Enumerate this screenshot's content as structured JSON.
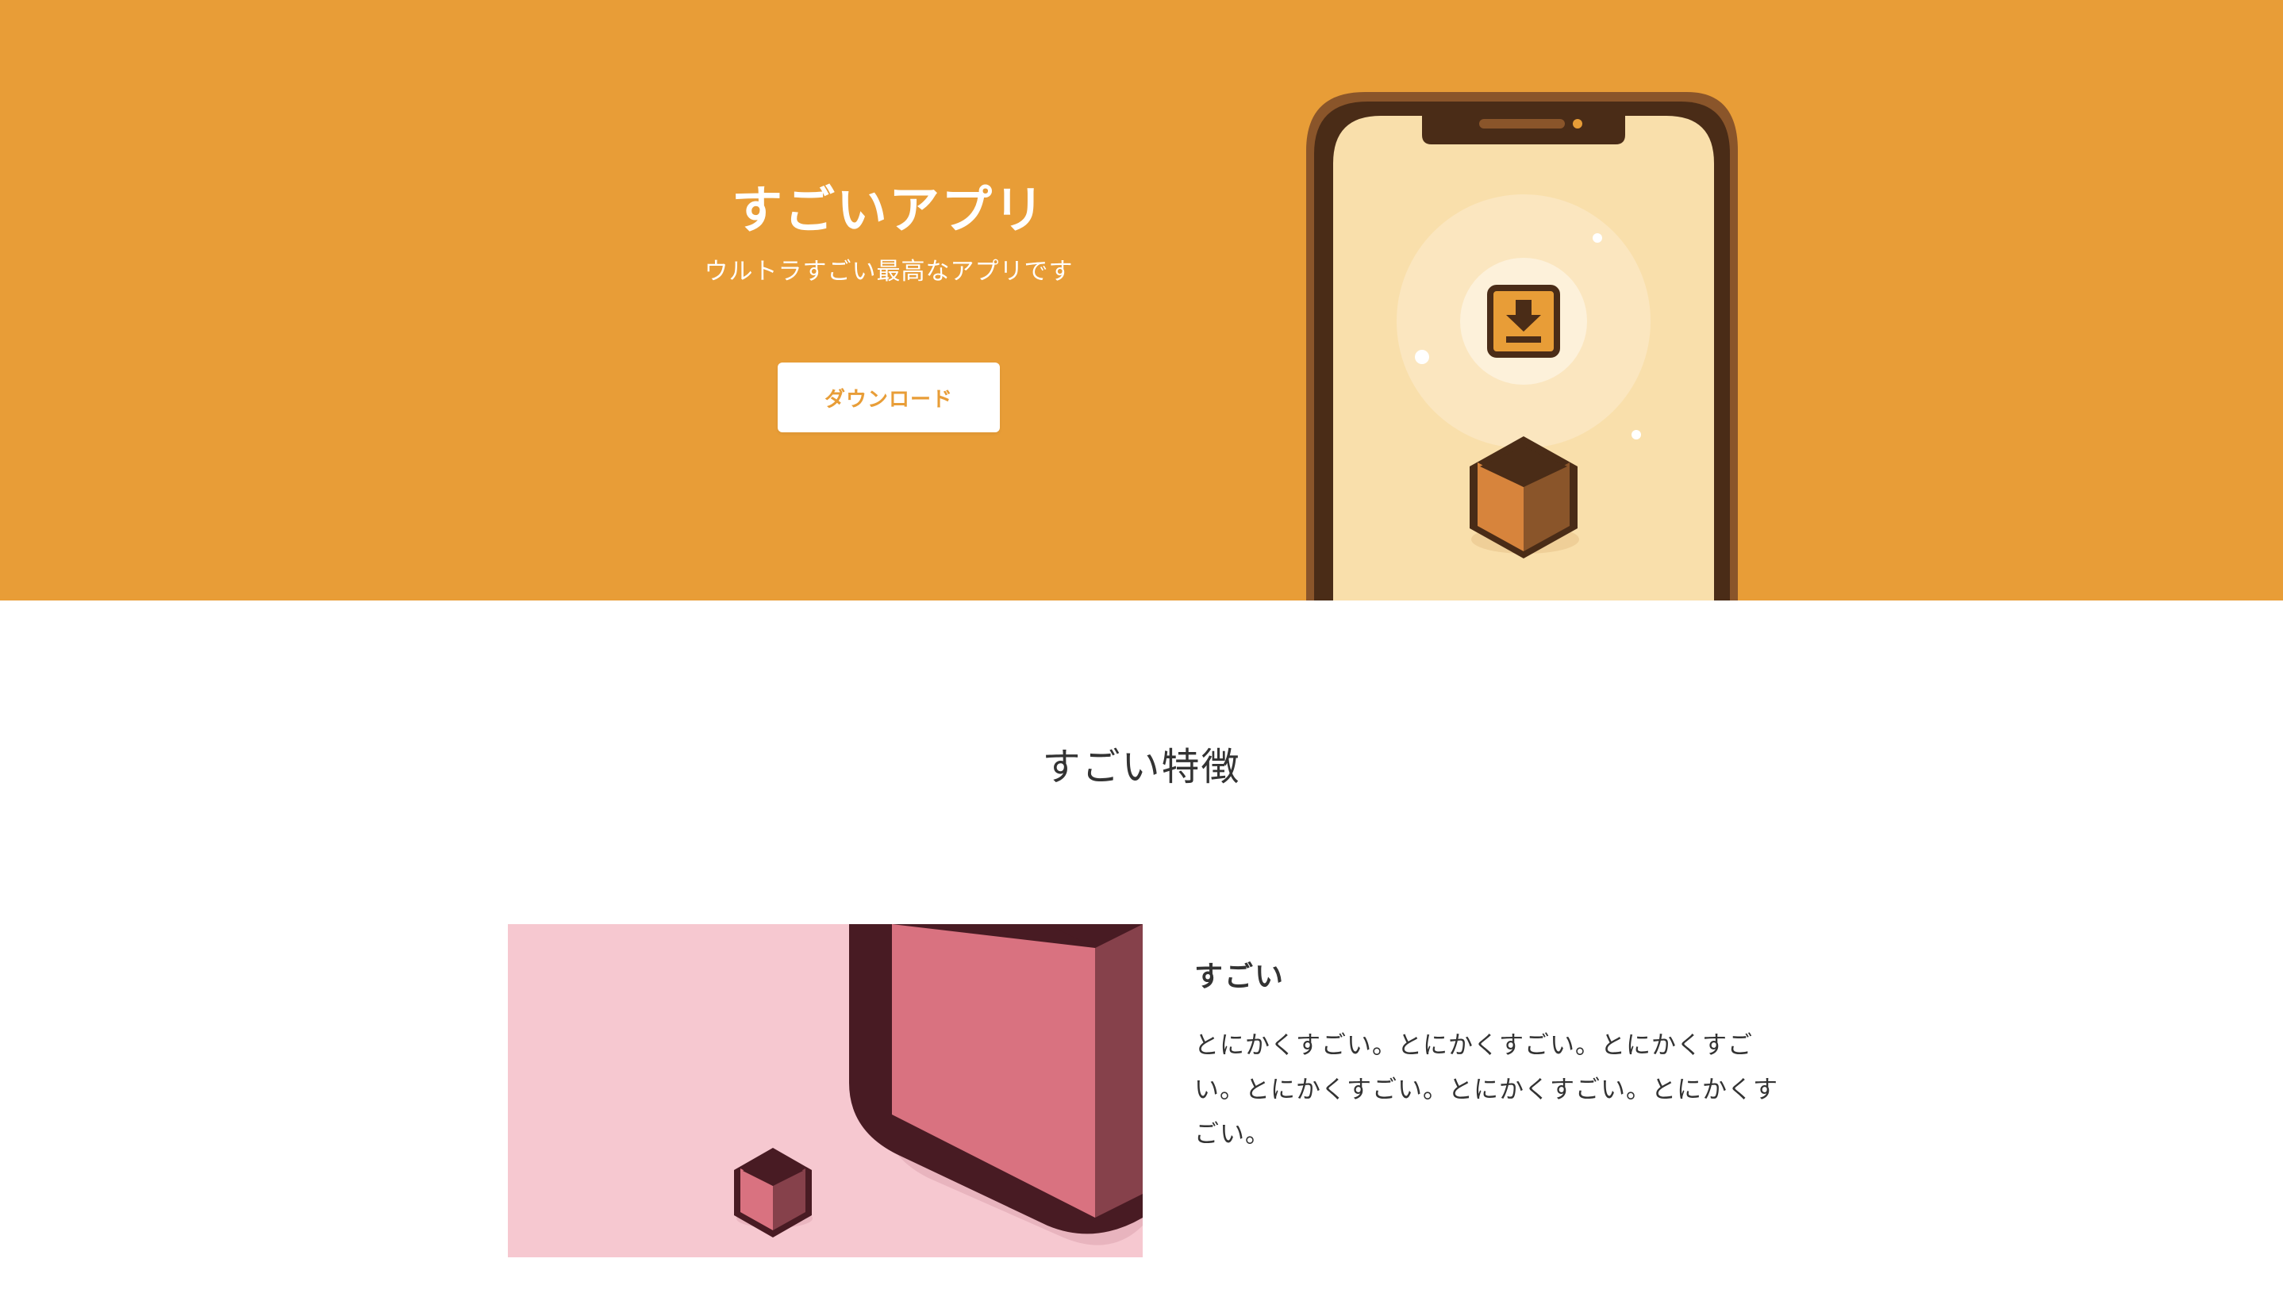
{
  "hero": {
    "title": "すごいアプリ",
    "subtitle": "ウルトラすごい最高なアプリです",
    "download_label": "ダウンロード",
    "background_color": "#e89d37",
    "button_text_color": "#e89d37"
  },
  "phone": {
    "icons": [
      "download-icon",
      "box-icon"
    ]
  },
  "features": {
    "heading": "すごい特徴",
    "items": [
      {
        "title": "すごい",
        "description": "とにかくすごい。とにかくすごい。とにかくすごい。とにかくすごい。とにかくすごい。とにかくすごい。",
        "image_background": "#f6c8d0"
      }
    ]
  }
}
